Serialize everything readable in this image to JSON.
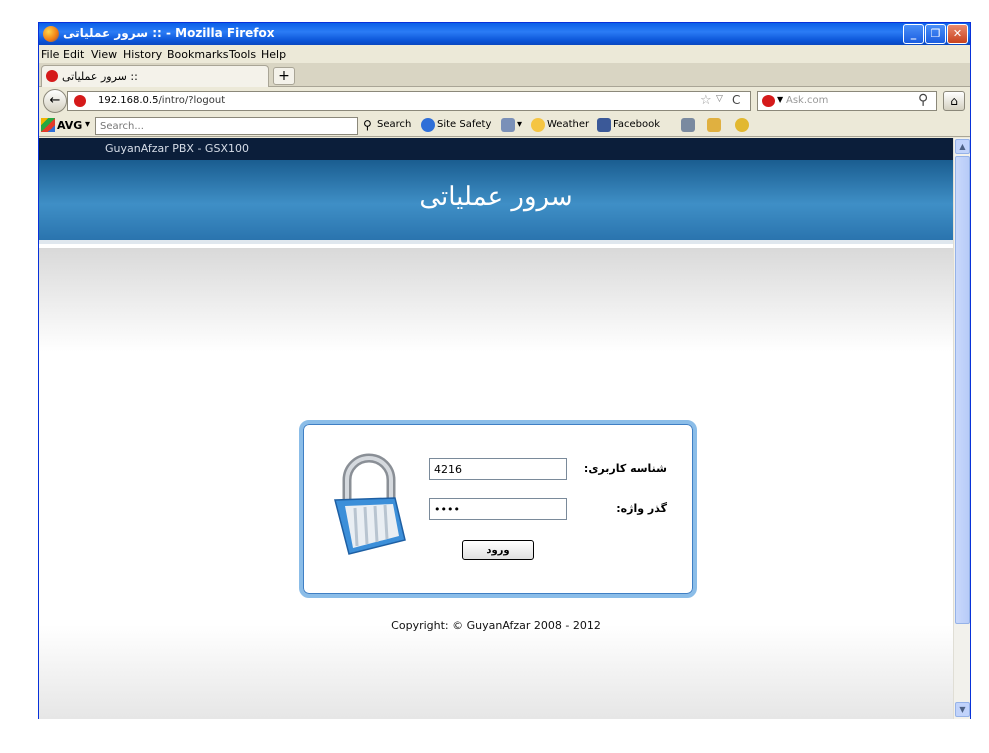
{
  "window": {
    "title": "سرور عملیاتی :: - Mozilla Firefox",
    "controls": {
      "minimize": "_",
      "maximize": "❐",
      "close": "✕"
    }
  },
  "menu": {
    "items": [
      "File",
      "Edit",
      "View",
      "History",
      "Bookmarks",
      "Tools",
      "Help"
    ]
  },
  "tabs": [
    {
      "label": "سرور عملیاتی :: "
    }
  ],
  "new_tab": "+",
  "nav": {
    "back": "←",
    "url_host": "192.168.0.5",
    "url_path": "/intro/?logout",
    "star": "☆",
    "dropdown": "▽",
    "reload": "C",
    "search_engine_dd": "▼",
    "search_placeholder": "Ask.com",
    "search_icon": "⚲",
    "home": "⌂"
  },
  "avg": {
    "label": "AVG",
    "dropdown": "▾",
    "search_placeholder": "Search...",
    "search_button": "Search",
    "site_safety": "Site Safety",
    "weather": "Weather",
    "facebook": "Facebook"
  },
  "page": {
    "product": "GuyanAfzar PBX - GSX100",
    "site_title": "سرور عملیاتی",
    "login": {
      "user_label": "شناسه کاربری:",
      "user_value": "4216",
      "pass_label": "گذر واژه:",
      "pass_value": "••••",
      "submit_label": "ورود"
    },
    "copyright": "Copyright: © GuyanAfzar 2008 - 2012"
  },
  "colors": {
    "title_bar": "#0a5fe8",
    "top_nav": "#0b1e3a",
    "banner": "#3f8fc6",
    "login_border": "#8bbde8"
  },
  "scrollbar": {
    "up": "▲",
    "down": "▼"
  }
}
